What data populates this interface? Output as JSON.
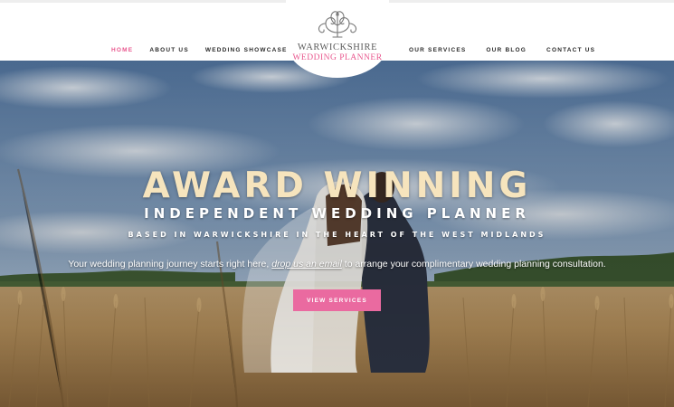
{
  "nav": {
    "left": [
      "HOME",
      "ABOUT US",
      "WEDDING SHOWCASE"
    ],
    "right": [
      "OUR SERVICES",
      "OUR BLOG",
      "CONTACT US"
    ],
    "active": "HOME"
  },
  "logo": {
    "line1": "WARWICKSHIRE",
    "line2": "WEDDING PLANNER",
    "icon": "ornamental-scroll-icon"
  },
  "hero": {
    "headline": "AWARD WINNING",
    "subheadline": "INDEPENDENT WEDDING PLANNER",
    "tagline": "BASED IN WARWICKSHIRE IN THE HEART OF THE WEST MIDLANDS",
    "intro_before": "Your wedding planning journey starts right here,",
    "intro_link": "drop us an email",
    "intro_after": "to arrange your complimentary wedding planning consultation.",
    "cta_label": "VIEW SERVICES"
  },
  "colors": {
    "accent_pink": "#e9578e",
    "button_pink": "#ea6aa0",
    "headline_cream": "#f6e4bd"
  }
}
